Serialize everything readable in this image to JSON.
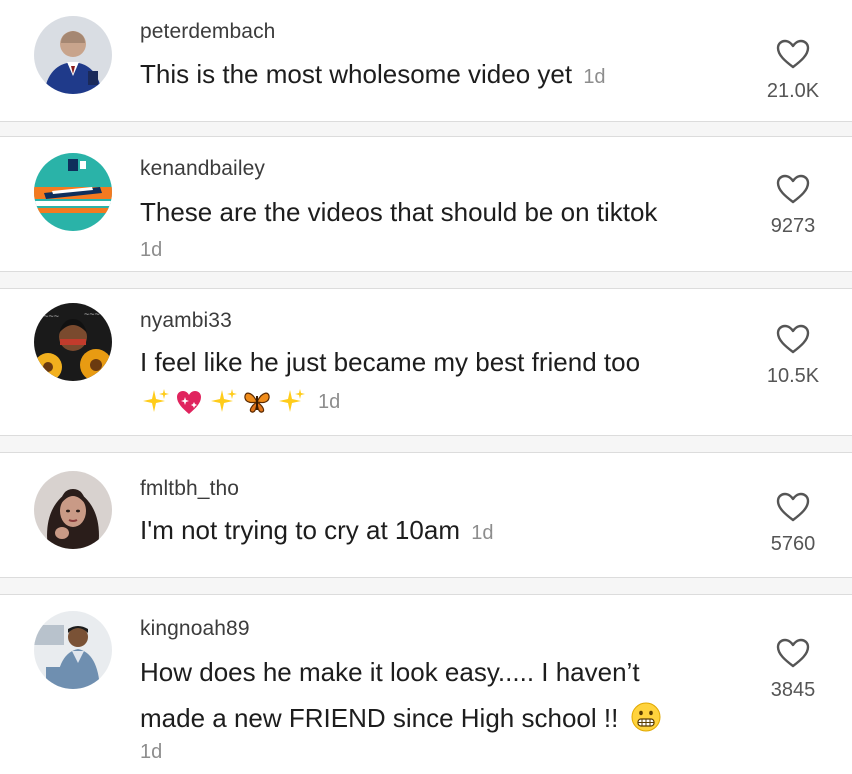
{
  "comments": [
    {
      "username": "peterdembach",
      "text": "This is the most wholesome video yet",
      "time": "1d",
      "likes": "21.0K",
      "avatar_icon": "avatar-man-suit"
    },
    {
      "username": "kenandbailey",
      "text": "These are the videos that should be on tiktok",
      "time": "1d",
      "likes": "9273",
      "avatar_icon": "avatar-islanders-jersey"
    },
    {
      "username": "nyambi33",
      "text": "I feel like he just became my best friend too",
      "emojis": [
        "sparkles-icon",
        "sparkling-heart-icon",
        "sparkles-icon",
        "butterfly-icon",
        "sparkles-icon"
      ],
      "time": "1d",
      "likes": "10.5K",
      "avatar_icon": "avatar-sunflowers"
    },
    {
      "username": "fmltbh_tho",
      "text": "I'm not trying to cry at 10am",
      "time": "1d",
      "likes": "5760",
      "avatar_icon": "avatar-woman"
    },
    {
      "username": "kingnoah89",
      "text_line1": "How does he make it look easy..... I haven’t",
      "text_line2": "made a new FRIEND since High school !!",
      "trailing_emoji": "grimacing-face-icon",
      "time": "1d",
      "likes": "3845",
      "avatar_icon": "avatar-man-denim"
    }
  ],
  "colors": {
    "text": "#1d1d1d",
    "username": "#3c3c3c",
    "timestamp": "#8d8d8d",
    "divider": "#dcdcdc",
    "separator_bg": "#f6f6f6"
  }
}
